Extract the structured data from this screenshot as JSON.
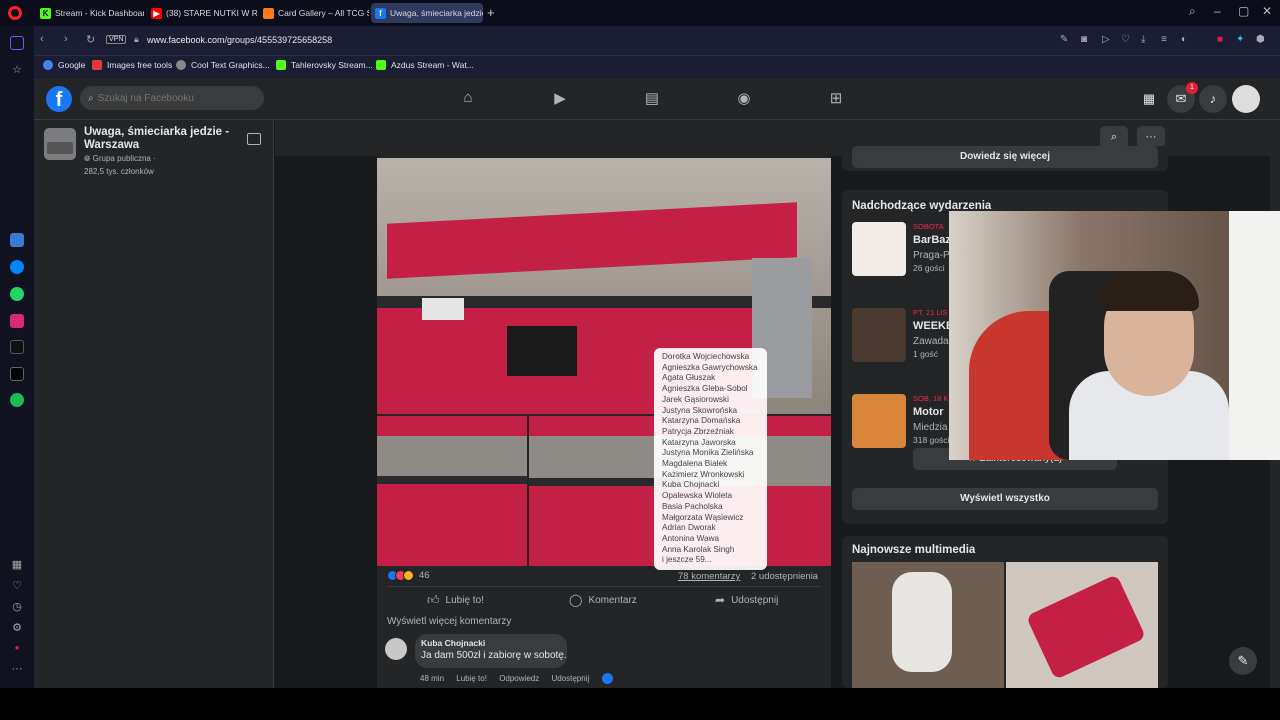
{
  "browser": {
    "tabs": [
      {
        "label": "Stream - Kick Dashboard",
        "icon": "kick-icon",
        "color": "#53fc18"
      },
      {
        "label": "(38) STARE NUTKI W R",
        "icon": "youtube-icon",
        "color": "#ff0000"
      },
      {
        "label": "Card Gallery – All TCG Sets",
        "icon": "card-gallery-icon",
        "color": "#ff7a1a"
      },
      {
        "label": "Uwaga, śmieciarka jedzie",
        "icon": "facebook-icon",
        "color": "#1877f2"
      }
    ],
    "vpn_label": "VPN",
    "url": "www.facebook.com/groups/455539725658258",
    "bookmarks": [
      {
        "label": "Google",
        "icon": "google-icon",
        "color": "#4285f4"
      },
      {
        "label": "Images free tools",
        "icon": "images-icon",
        "color": "#e53935"
      },
      {
        "label": "Cool Text Graphics...",
        "icon": "cooltext-icon",
        "color": "#888888"
      },
      {
        "label": "Tahlerovsky Stream...",
        "icon": "kick-icon",
        "color": "#53fc18"
      },
      {
        "label": "Azdus Stream - Wat...",
        "icon": "kick-icon",
        "color": "#53fc18"
      }
    ]
  },
  "facebook": {
    "logo": "f",
    "search_placeholder": "Szukaj na Facebooku",
    "notifications_badge": "1",
    "group": {
      "name": "Uwaga, śmieciarka jedzie - Warszawa",
      "type": "Grupa publiczna ·",
      "members": "282,5 tys. członków"
    },
    "post": {
      "reaction_count": "46",
      "comments": "78 komentarzy",
      "shares": "2 udostępnienia",
      "like_label": "Lubię to!",
      "comment_label": "Komentarz",
      "share_label": "Udostępnij",
      "more_comments": "Wyświetl więcej komentarzy",
      "reactors": [
        "Dorotka Wojciechowska",
        "Agnieszka Gawrychowska",
        "Agata Głuszak",
        "Agnieszka Gleba-Sobol",
        "Jarek Gąsiorowski",
        "Justyna Skowrońska",
        "Katarzyna Domańska",
        "Patrycja Zbrzeźniak",
        "Katarzyna Jaworska",
        "Justyna Monika Zielińska",
        "Magdalena Białek",
        "Kazimierz Wronkowski",
        "Kuba Chojnacki",
        "Opalewska Wioleta",
        "Basia Pacholska",
        "Małgorzata Wąsiewicz",
        "Adrian Dworak",
        "Antonina Wawa",
        "Anna Karolak Singh",
        "i jeszcze 59..."
      ],
      "comment": {
        "author": "Kuba Chojnacki",
        "text": "Ja dam 500zł i zabiorę w sobotę.",
        "time": "48 min",
        "like": "Lubię to!",
        "reply": "Odpowiedz",
        "share": "Udostępnij"
      }
    },
    "right": {
      "learn_more": "Dowiedz się więcej",
      "events_title": "Nadchodzące wydarzenia",
      "events": [
        {
          "date": "SOBOTA",
          "name": "BarBaz",
          "location": "Praga-P",
          "guests": "26 gości"
        },
        {
          "date": "PT, 21 LIS",
          "name": "WEEKE",
          "location": "Zawada,",
          "guests": "1 gość"
        },
        {
          "date": "SOB, 18 K",
          "name": "Motor",
          "location": "Miedzia",
          "guests": "318 gości"
        }
      ],
      "interested": "Zainteresowany(a)",
      "show_all": "Wyświetl wszystko",
      "media_title": "Najnowsze multimedia"
    }
  }
}
